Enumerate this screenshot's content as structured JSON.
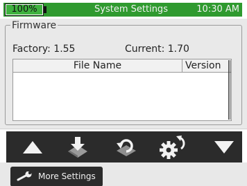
{
  "status_bar": {
    "battery_percent": 100,
    "battery_label": "100%",
    "title": "System Settings",
    "time": "10:30 AM"
  },
  "firmware": {
    "legend": "Firmware",
    "factory_label": "Factory: 1.55",
    "current_label": "Current: 1.70",
    "table": {
      "columns": [
        "File Name",
        "Version"
      ],
      "rows": []
    }
  },
  "toolbar": {
    "buttons": [
      {
        "name": "up-arrow-icon"
      },
      {
        "name": "download-icon"
      },
      {
        "name": "undo-icon"
      },
      {
        "name": "settings-refresh-icon"
      },
      {
        "name": "down-arrow-icon"
      }
    ]
  },
  "bottom_bar": {
    "more_settings_label": "More Settings",
    "more_settings_icon": "wrench-icon"
  },
  "colors": {
    "status_green": "#2f9a2f",
    "toolbar_dark": "#2b2b2b",
    "panel_bg": "#e9e9e9"
  }
}
